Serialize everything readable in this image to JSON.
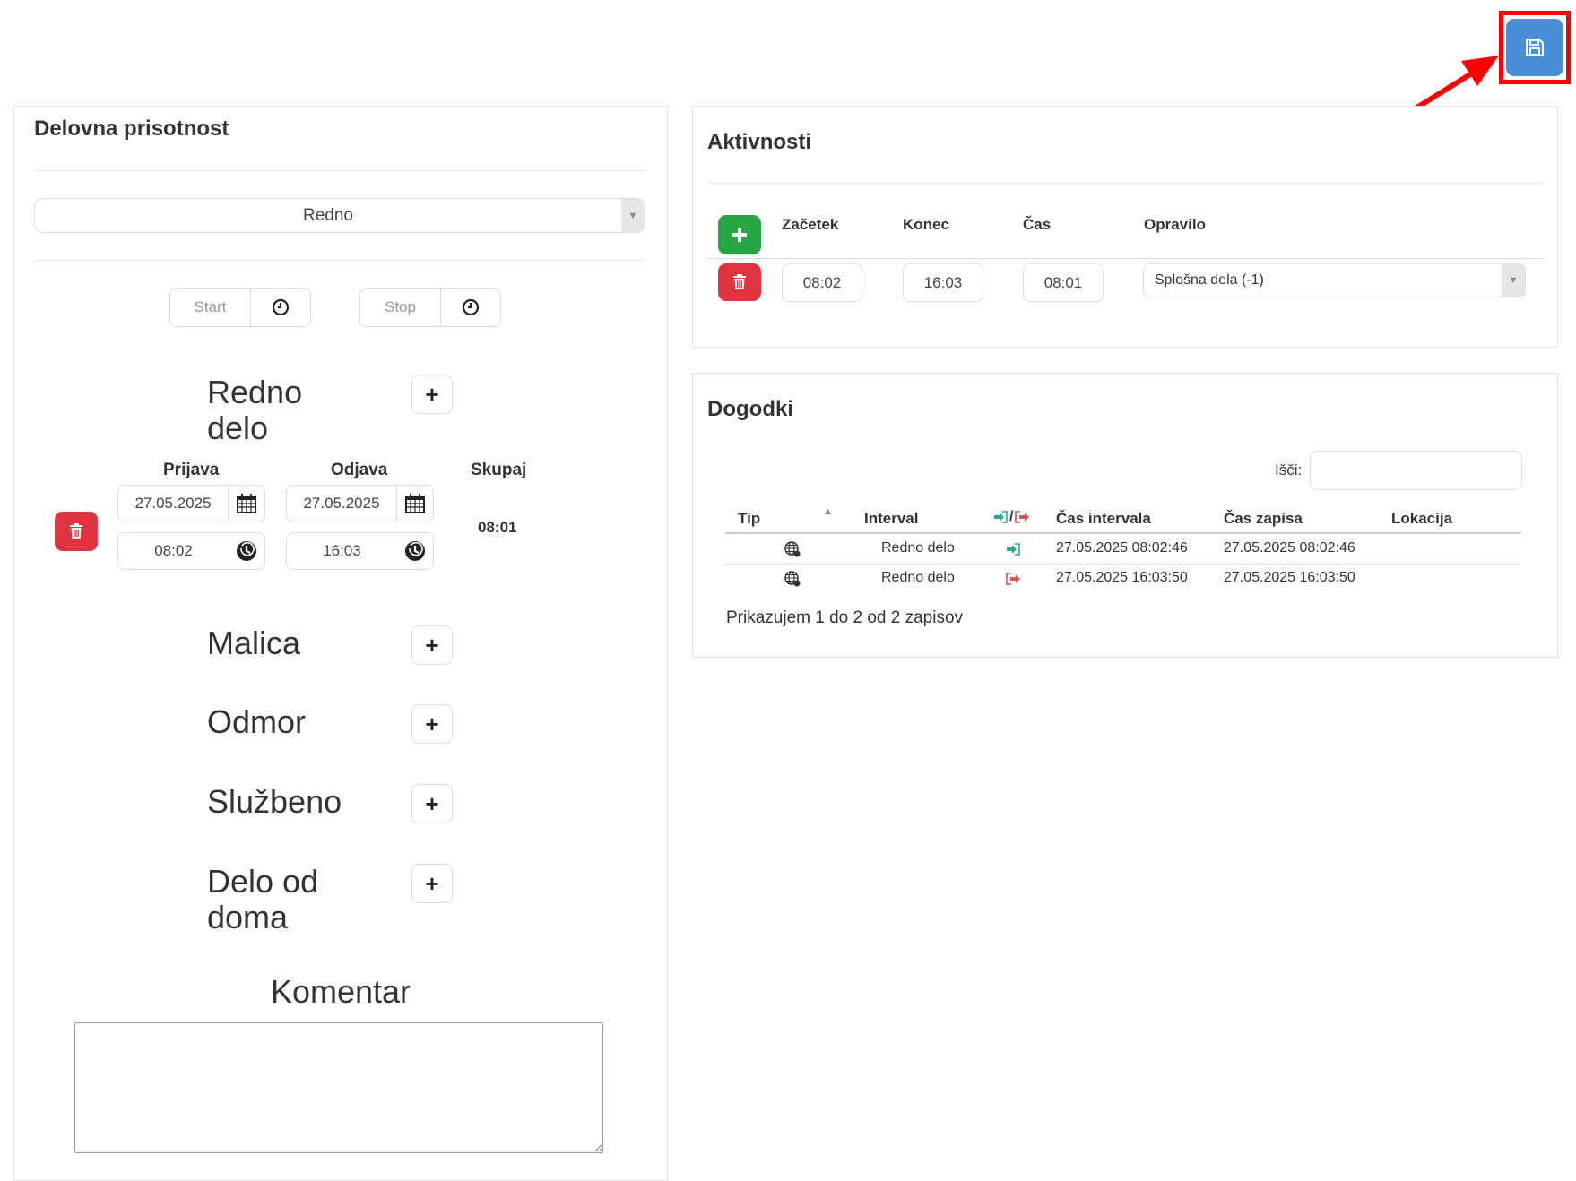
{
  "toolbar": {
    "save_icon": "floppy-disk-icon"
  },
  "annotation": {
    "color": "#ff0000"
  },
  "left": {
    "title": "Delovna prisotnost",
    "mode_select": {
      "value": "Redno"
    },
    "start_placeholder": "Start",
    "stop_placeholder": "Stop",
    "categories": {
      "redno_line1": "Redno",
      "redno_line2": "delo",
      "malica": "Malica",
      "odmor": "Odmor",
      "sluzbeno": "Službeno",
      "dod_line1": "Delo od",
      "dod_line2": "doma"
    },
    "interval": {
      "prijava_label": "Prijava",
      "odjava_label": "Odjava",
      "skupaj_label": "Skupaj",
      "prijava_date": "27.05.2025",
      "prijava_time": "08:02",
      "odjava_date": "27.05.2025",
      "odjava_time": "16:03",
      "skupaj_value": "08:01"
    },
    "comment": {
      "title": "Komentar",
      "value": ""
    }
  },
  "activities": {
    "title": "Aktivnosti",
    "headers": {
      "zacetek": "Začetek",
      "konec": "Konec",
      "cas": "Čas",
      "opravilo": "Opravilo"
    },
    "row": {
      "zacetek": "08:02",
      "konec": "16:03",
      "cas": "08:01",
      "opravilo": "Splošna dela (-1)"
    }
  },
  "events": {
    "title": "Dogodki",
    "search_label": "Išči:",
    "search_value": "",
    "headers": {
      "tip": "Tip",
      "interval": "Interval",
      "inout": "/",
      "cas_intervala": "Čas intervala",
      "cas_zapisa": "Čas zapisa",
      "lokacija": "Lokacija"
    },
    "rows": [
      {
        "tip_icon": "globe-icon",
        "interval": "Redno delo",
        "direction": "sign-in-icon",
        "cas_intervala": "27.05.2025 08:02:46",
        "cas_zapisa": "27.05.2025 08:02:46",
        "lokacija": ""
      },
      {
        "tip_icon": "globe-icon",
        "interval": "Redno delo",
        "direction": "sign-out-icon",
        "cas_intervala": "27.05.2025 16:03:50",
        "cas_zapisa": "27.05.2025 16:03:50",
        "lokacija": ""
      }
    ],
    "footer": "Prikazujem 1 do 2 od 2 zapisov"
  }
}
